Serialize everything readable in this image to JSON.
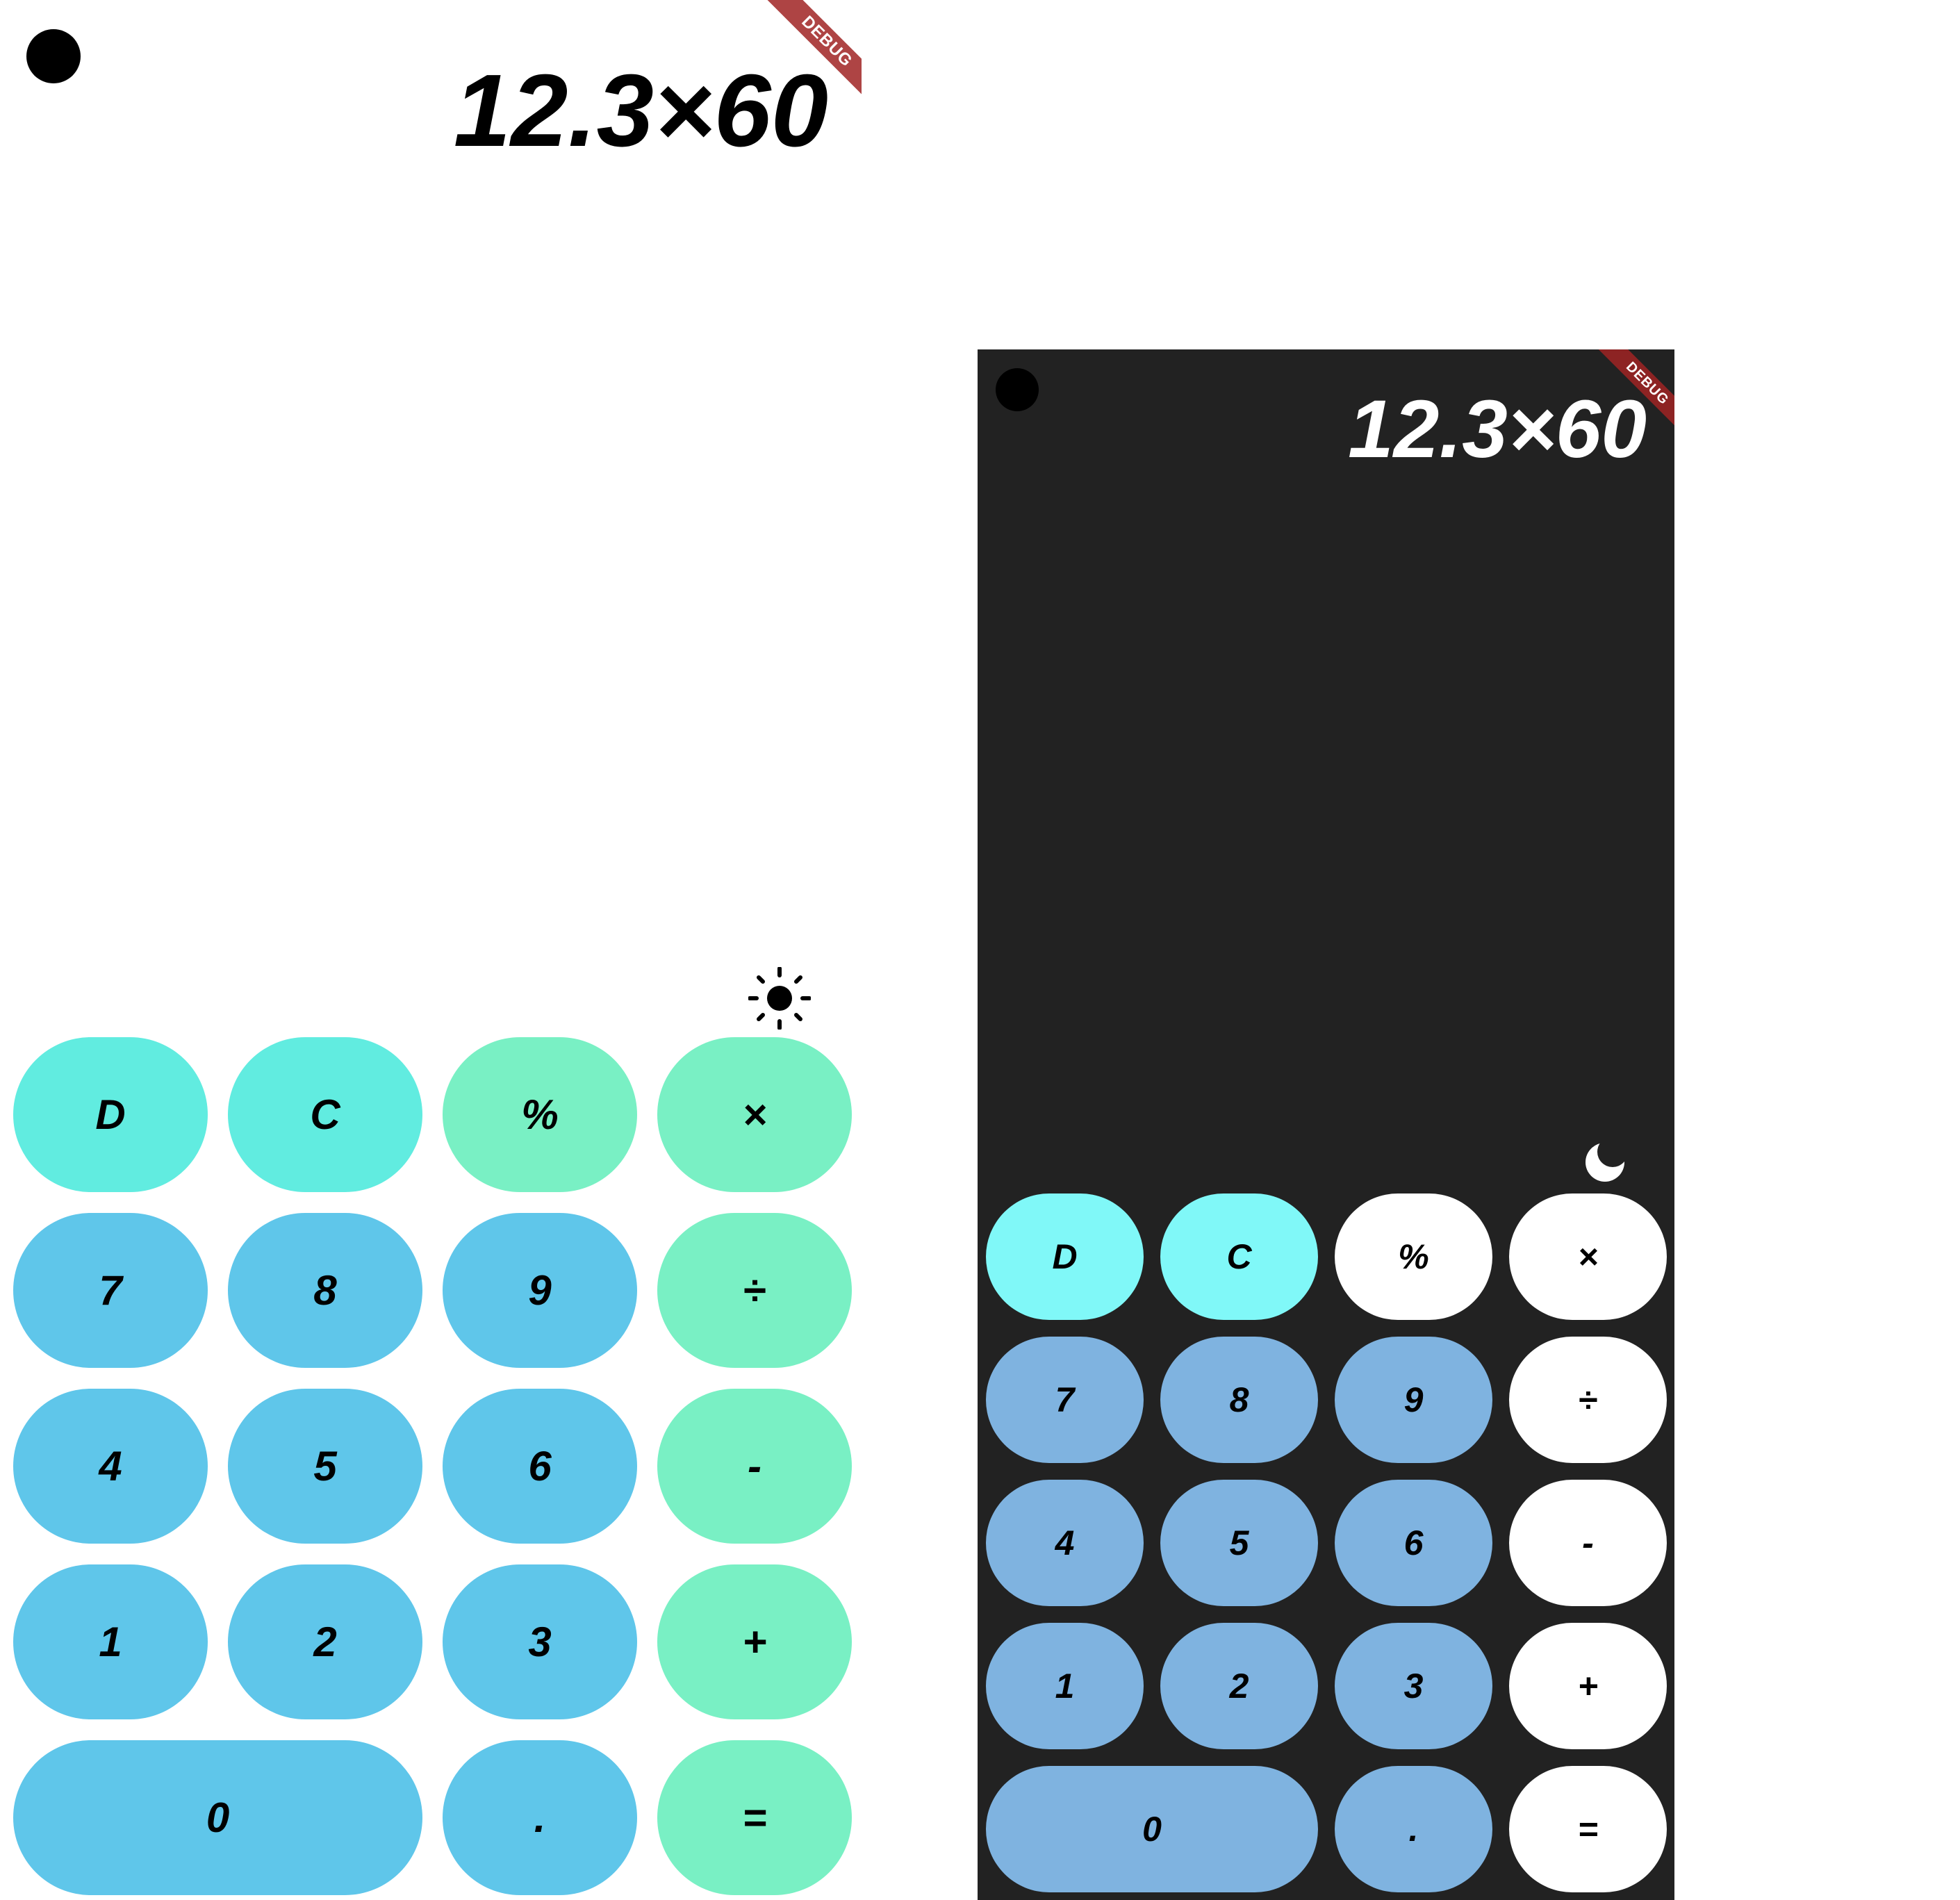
{
  "light_screen": {
    "expression": "12.3×60",
    "debug_label": "DEBUG",
    "theme_icon": "sun-icon",
    "colors": {
      "background": "#ffffff",
      "display_text": "#000000",
      "action_key": "#61ece0",
      "number_key": "#5fc6ea",
      "operator_key": "#79f0c4"
    },
    "keys": {
      "delete": "D",
      "clear": "C",
      "percent": "%",
      "multiply": "×",
      "seven": "7",
      "eight": "8",
      "nine": "9",
      "divide": "÷",
      "four": "4",
      "five": "5",
      "six": "6",
      "subtract": "-",
      "one": "1",
      "two": "2",
      "three": "3",
      "add": "+",
      "zero": "0",
      "decimal": ".",
      "equals": "="
    }
  },
  "dark_screen": {
    "expression": "12.3×60",
    "debug_label": "DEBUG",
    "theme_icon": "moon-icon",
    "colors": {
      "background": "#222222",
      "display_text": "#ffffff",
      "action_key": "#80f8f8",
      "number_key": "#7fb3e0",
      "operator_key": "#ffffff"
    },
    "keys": {
      "delete": "D",
      "clear": "C",
      "percent": "%",
      "multiply": "×",
      "seven": "7",
      "eight": "8",
      "nine": "9",
      "divide": "÷",
      "four": "4",
      "five": "5",
      "six": "6",
      "subtract": "-",
      "one": "1",
      "two": "2",
      "three": "3",
      "add": "+",
      "zero": "0",
      "decimal": ".",
      "equals": "="
    }
  }
}
